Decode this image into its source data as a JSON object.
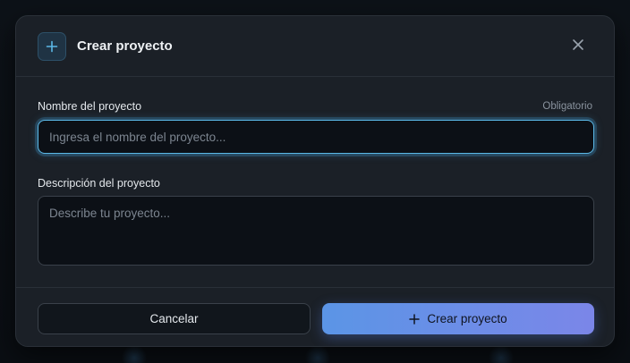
{
  "dialog": {
    "title": "Crear proyecto",
    "header_icon": "plus-icon",
    "close_icon": "close-icon"
  },
  "fields": {
    "name": {
      "label": "Nombre del proyecto",
      "hint": "Obligatorio",
      "placeholder": "Ingresa el nombre del proyecto...",
      "value": ""
    },
    "description": {
      "label": "Descripción del proyecto",
      "placeholder": "Describe tu proyecto...",
      "value": ""
    }
  },
  "actions": {
    "cancel_label": "Cancelar",
    "create_label": "Crear proyecto",
    "create_icon": "plus-icon"
  },
  "colors": {
    "accent": "#5bb8e6",
    "primary_gradient_start": "#5b95e6",
    "primary_gradient_end": "#7b86e8",
    "surface": "#1b2027",
    "input_bg": "#0c1016"
  }
}
